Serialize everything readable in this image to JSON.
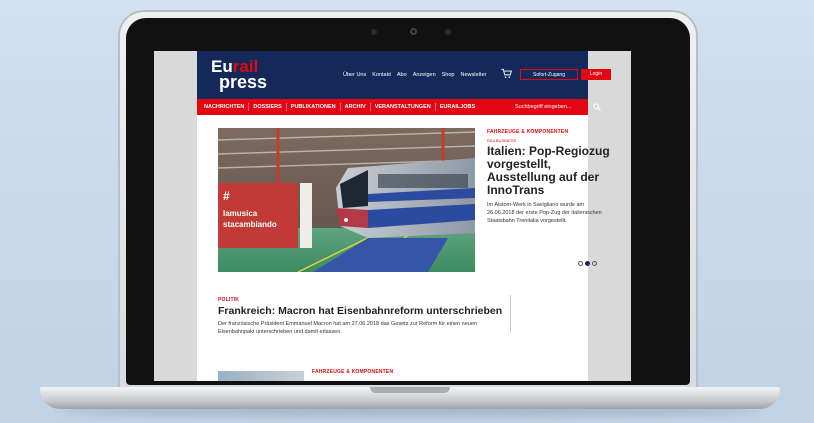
{
  "header": {
    "logo_eu": "Eu",
    "logo_rail": "rail",
    "logo_press": "press",
    "topnav": [
      "Über Uns",
      "Kontakt",
      "Abo",
      "Anzeigen",
      "Shop",
      "Newsletter"
    ],
    "sofort_label": "Sofort-Zugang",
    "login_label": "Login"
  },
  "mainnav": {
    "items": [
      "NACHRICHTEN",
      "DOSSIERS",
      "PUBLIKATIONEN",
      "ARCHIV",
      "VERANSTALTUNGEN",
      "EURAILJOBS"
    ],
    "search_placeholder": "Suchbegriff eingeben..."
  },
  "hero": {
    "category": "FAHRZEUGE & KOMPONENTEN",
    "tag": "RAILBUSINESS",
    "title": "Italien: Pop-Regiozug vorgestellt, Ausstellung auf der InnoTrans",
    "text": "Im Alstom-Werk in Savigliano wurde am 26.06.2018 der erste Pop-Zug der italienischen Staatsbahn Trenitalia vorgestellt.",
    "banner_line1": "#",
    "banner_line2": "lamusica",
    "banner_line3": "stacambiando",
    "carousel_count": 3,
    "carousel_active": 2
  },
  "article2": {
    "category": "POLITIK",
    "title": "Frankreich: Macron hat Eisenbahnreform unterschrieben",
    "text": "Der französische Präsident Emmanuel Macron hat am 27.06.2018 das Gesetz zur Reform für einen neuen Eisenbahnpakt unterschrieben und damit erlassen."
  },
  "article3": {
    "category": "FAHRZEUGE & KOMPONENTEN"
  },
  "colors": {
    "navy": "#14285a",
    "red": "#e30613"
  }
}
